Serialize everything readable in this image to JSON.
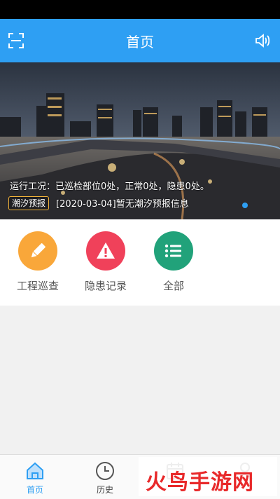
{
  "header": {
    "title": "首页",
    "scan_icon": "scan-icon",
    "speaker_icon": "speaker-icon"
  },
  "banner": {
    "line1": "运行工况：已巡检部位0处，正常0处，隐患0处。",
    "tag": "潮汐预报",
    "line2": "[2020-03-04]暂无潮汐预报信息"
  },
  "grid": [
    {
      "label": "工程巡查",
      "icon": "pencil-icon",
      "color": "#f9a73a"
    },
    {
      "label": "隐患记录",
      "icon": "warning-icon",
      "color": "#f0415a"
    },
    {
      "label": "全部",
      "icon": "list-icon",
      "color": "#21a27a"
    }
  ],
  "tabs": [
    {
      "label": "首页",
      "icon": "home-icon",
      "active": true
    },
    {
      "label": "历史",
      "icon": "clock-icon",
      "active": false
    },
    {
      "label": "",
      "icon": "calendar-icon",
      "active": false
    },
    {
      "label": "",
      "icon": "user-icon",
      "active": false
    }
  ],
  "watermark": {
    "text": "火鸟手游网"
  },
  "colors": {
    "primary": "#2e9ff3",
    "tag_border": "#f4b43a"
  }
}
